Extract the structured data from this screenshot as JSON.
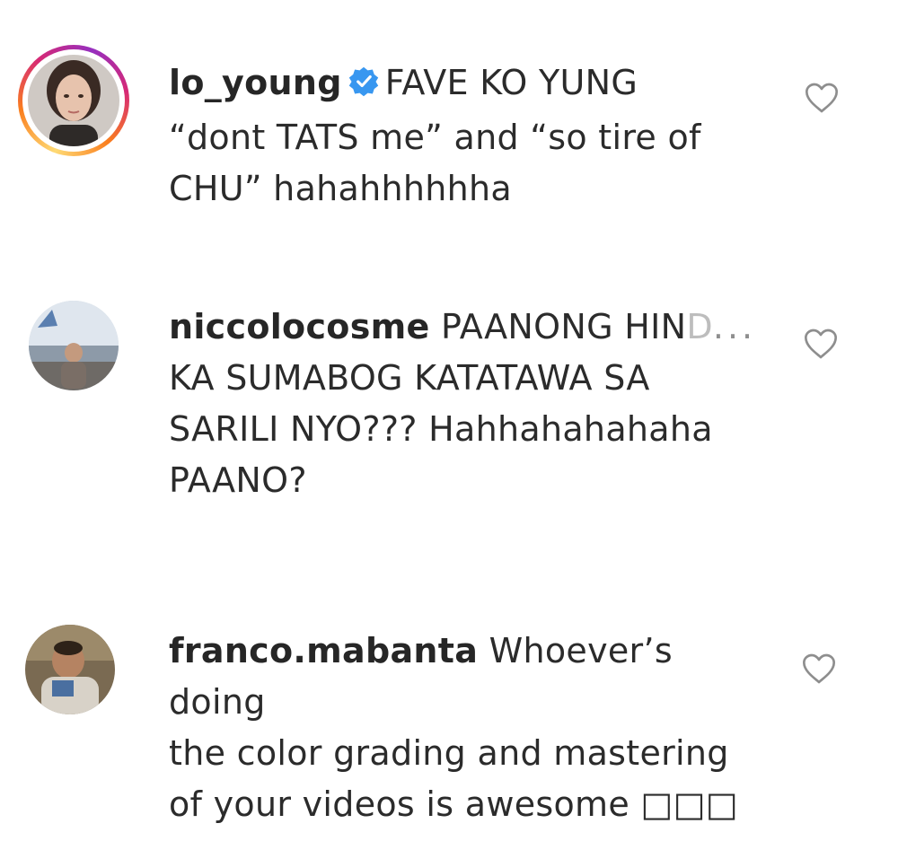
{
  "comments": [
    {
      "username": "lo_young",
      "verified": true,
      "lines": [
        "FAVE KO YUNG",
        "“dont TATS me” and “so tire of",
        "CHU” hahahhhhhha"
      ]
    },
    {
      "username": "niccolocosme",
      "verified": false,
      "first_line_visible": "PAANONG HIN",
      "first_line_faded": "D",
      "more": "...",
      "lines": [
        "KA SUMABOG KATATAWA SA",
        "SARILI NYO??? Hahhahahahaha",
        "PAANO?"
      ]
    },
    {
      "username": "franco.mabanta",
      "verified": false,
      "lines": [
        "Whoever’s doing",
        "the color grading and mastering",
        "of your videos is awesome □□□"
      ]
    }
  ],
  "colors": {
    "verified_badge": "#3897f0",
    "heart_stroke": "#8e8e8e",
    "text": "#262626"
  },
  "icons": {
    "like": "heart-icon",
    "verified": "verified-badge-icon"
  }
}
